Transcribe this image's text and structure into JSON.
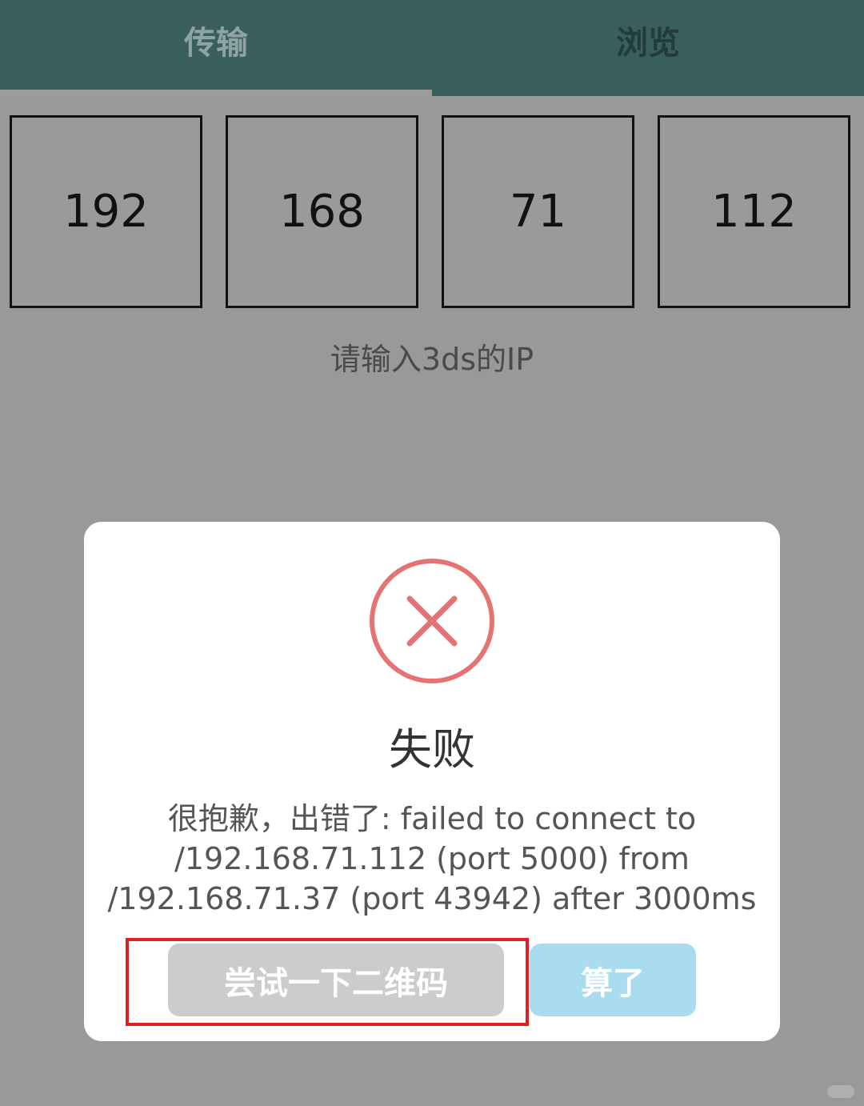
{
  "tabs": {
    "transfer_label": "传输",
    "browse_label": "浏览"
  },
  "ip": {
    "octets": [
      "192",
      "168",
      "71",
      "112"
    ],
    "hint": "请输入3ds的IP"
  },
  "dialog": {
    "icon": "error-x-circle-icon",
    "icon_color": "#e57373",
    "title": "失败",
    "message": "很抱歉，出错了: failed to connect to /192.168.71.112 (port 5000) from /192.168.71.37 (port 43942) after 3000ms",
    "qr_button_label": "尝试一下二维码",
    "cancel_button_label": "算了"
  },
  "colors": {
    "tabbar": "#385e5e",
    "overlay": "#999999",
    "highlight": "#e02020",
    "cancel_button": "#aadcef",
    "qr_button": "#cccccc"
  }
}
